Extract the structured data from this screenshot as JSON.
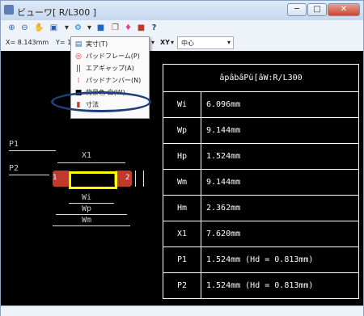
{
  "window": {
    "title": "ビューワ[ R/L300 ]",
    "minimize": "─",
    "maximize": "□",
    "close": "✕"
  },
  "toolbar2": {
    "x_coord": "X= 8.143mm",
    "y_coord": "Y= 16",
    "xy_label": "XY",
    "align_value": "中心"
  },
  "menu": {
    "items": [
      {
        "label": "実寸(T)",
        "icon": "measure-icon"
      },
      {
        "label": "パッドフレーム(P)",
        "icon": "pad-frame-icon"
      },
      {
        "label": "エアギャップ(A)",
        "icon": "air-gap-icon"
      },
      {
        "label": "パッドナンバー(N)",
        "icon": "pad-number-icon"
      },
      {
        "label": "背景色 白(W)",
        "icon": "background-icon"
      },
      {
        "label": "寸法",
        "icon": "dimension-icon"
      }
    ]
  },
  "info_table": {
    "header": "âpâbâPü[âW:R/L300",
    "rows": [
      {
        "key": "Wi",
        "value": "6.096mm"
      },
      {
        "key": "Wp",
        "value": "9.144mm"
      },
      {
        "key": "Hp",
        "value": "1.524mm"
      },
      {
        "key": "Wm",
        "value": "9.144mm"
      },
      {
        "key": "Hm",
        "value": "2.362mm"
      },
      {
        "key": "X1",
        "value": "7.620mm"
      },
      {
        "key": "P1",
        "value": "1.524mm (Hd = 0.813mm)"
      },
      {
        "key": "P2",
        "value": "1.524mm (Hd = 0.813mm)"
      }
    ]
  },
  "diagram": {
    "p1": "P1",
    "p2": "P2",
    "x1": "X1",
    "wi": "Wi",
    "wp": "Wp",
    "wm": "Wm",
    "pad1": "1",
    "pad2": "2"
  },
  "colors": {
    "pad": "#c0392b",
    "body": "#ffff00",
    "background": "#000000"
  }
}
